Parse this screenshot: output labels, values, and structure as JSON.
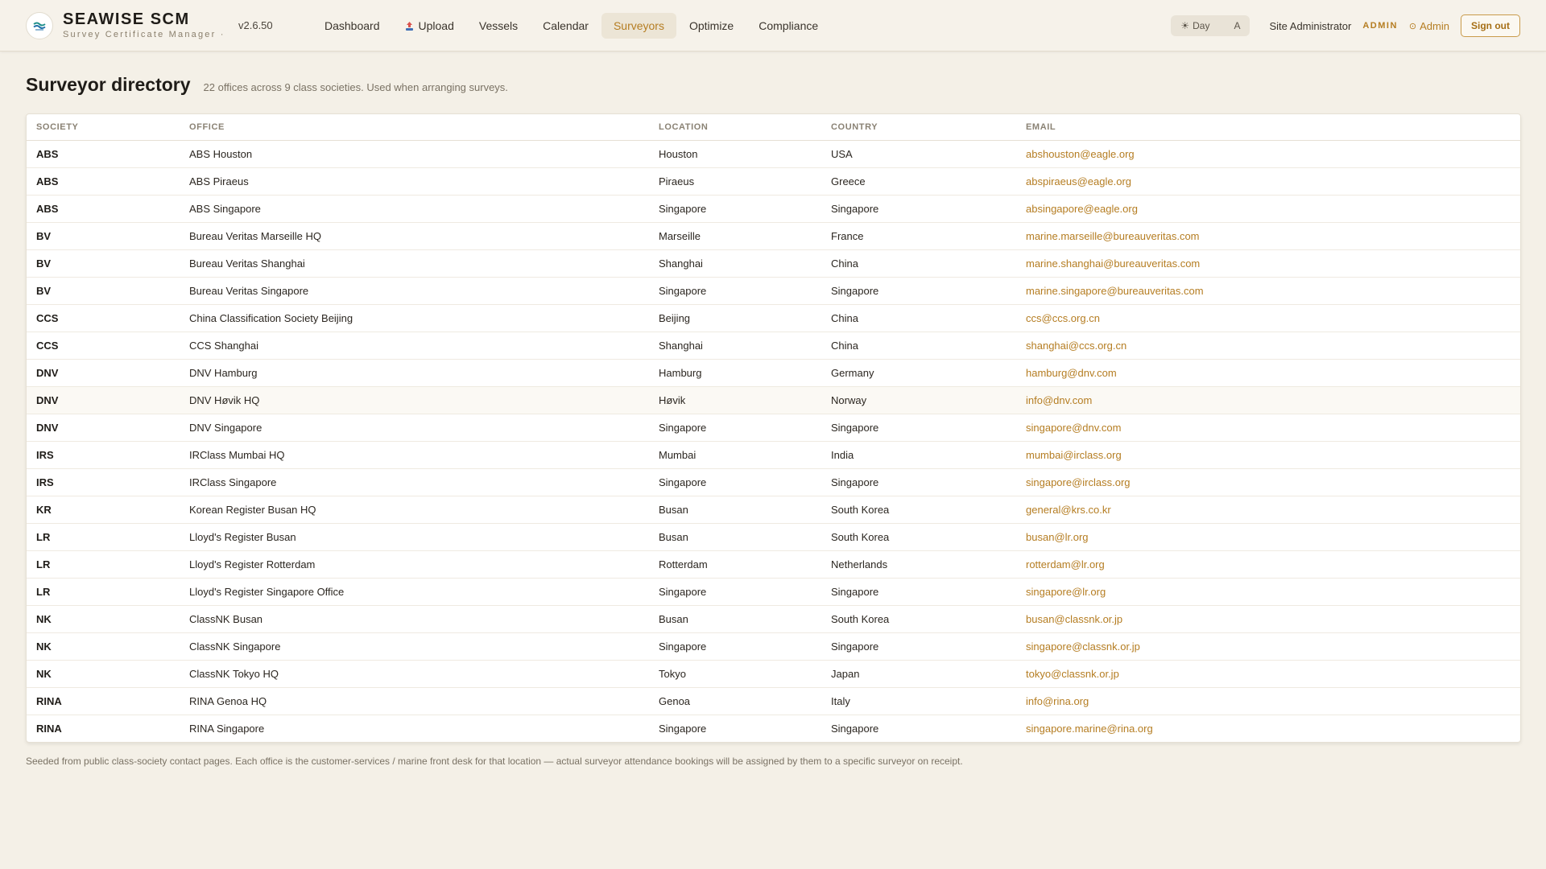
{
  "brand": {
    "name": "SEAWISE SCM",
    "subtitle": "Survey Certificate Manager ·"
  },
  "version": "v2.6.50",
  "nav": [
    {
      "label": "Dashboard",
      "active": false
    },
    {
      "label": "Upload",
      "active": false,
      "icon": "upload-icon"
    },
    {
      "label": "Vessels",
      "active": false
    },
    {
      "label": "Calendar",
      "active": false
    },
    {
      "label": "Surveyors",
      "active": true
    },
    {
      "label": "Optimize",
      "active": false
    },
    {
      "label": "Compliance",
      "active": false
    }
  ],
  "theme": {
    "day_label": "Day",
    "auto_label": "A",
    "day_icon": "sun-icon"
  },
  "user": {
    "name": "Site Administrator",
    "role": "ADMIN",
    "admin_link": "Admin",
    "signout": "Sign out"
  },
  "page": {
    "title": "Surveyor directory",
    "subtitle": "22 offices across 9 class societies. Used when arranging surveys."
  },
  "table": {
    "columns": [
      "SOCIETY",
      "OFFICE",
      "LOCATION",
      "COUNTRY",
      "EMAIL"
    ],
    "rows": [
      [
        "ABS",
        "ABS Houston",
        "Houston",
        "USA",
        "abshouston@eagle.org"
      ],
      [
        "ABS",
        "ABS Piraeus",
        "Piraeus",
        "Greece",
        "abspiraeus@eagle.org"
      ],
      [
        "ABS",
        "ABS Singapore",
        "Singapore",
        "Singapore",
        "absingapore@eagle.org"
      ],
      [
        "BV",
        "Bureau Veritas Marseille HQ",
        "Marseille",
        "France",
        "marine.marseille@bureauveritas.com"
      ],
      [
        "BV",
        "Bureau Veritas Shanghai",
        "Shanghai",
        "China",
        "marine.shanghai@bureauveritas.com"
      ],
      [
        "BV",
        "Bureau Veritas Singapore",
        "Singapore",
        "Singapore",
        "marine.singapore@bureauveritas.com"
      ],
      [
        "CCS",
        "China Classification Society Beijing",
        "Beijing",
        "China",
        "ccs@ccs.org.cn"
      ],
      [
        "CCS",
        "CCS Shanghai",
        "Shanghai",
        "China",
        "shanghai@ccs.org.cn"
      ],
      [
        "DNV",
        "DNV Hamburg",
        "Hamburg",
        "Germany",
        "hamburg@dnv.com"
      ],
      [
        "DNV",
        "DNV Høvik HQ",
        "Høvik",
        "Norway",
        "info@dnv.com"
      ],
      [
        "DNV",
        "DNV Singapore",
        "Singapore",
        "Singapore",
        "singapore@dnv.com"
      ],
      [
        "IRS",
        "IRClass Mumbai HQ",
        "Mumbai",
        "India",
        "mumbai@irclass.org"
      ],
      [
        "IRS",
        "IRClass Singapore",
        "Singapore",
        "Singapore",
        "singapore@irclass.org"
      ],
      [
        "KR",
        "Korean Register Busan HQ",
        "Busan",
        "South Korea",
        "general@krs.co.kr"
      ],
      [
        "LR",
        "Lloyd's Register Busan",
        "Busan",
        "South Korea",
        "busan@lr.org"
      ],
      [
        "LR",
        "Lloyd's Register Rotterdam",
        "Rotterdam",
        "Netherlands",
        "rotterdam@lr.org"
      ],
      [
        "LR",
        "Lloyd's Register Singapore Office",
        "Singapore",
        "Singapore",
        "singapore@lr.org"
      ],
      [
        "NK",
        "ClassNK Busan",
        "Busan",
        "South Korea",
        "busan@classnk.or.jp"
      ],
      [
        "NK",
        "ClassNK Singapore",
        "Singapore",
        "Singapore",
        "singapore@classnk.or.jp"
      ],
      [
        "NK",
        "ClassNK Tokyo HQ",
        "Tokyo",
        "Japan",
        "tokyo@classnk.or.jp"
      ],
      [
        "RINA",
        "RINA Genoa HQ",
        "Genoa",
        "Italy",
        "info@rina.org"
      ],
      [
        "RINA",
        "RINA Singapore",
        "Singapore",
        "Singapore",
        "singapore.marine@rina.org"
      ]
    ],
    "highlighted_row": 9
  },
  "footnote": "Seeded from public class-society contact pages. Each office is the customer-services / marine front desk for that location — actual surveyor attendance bookings will be assigned by them to a specific surveyor on receipt.",
  "colors": {
    "accent": "#b57d22",
    "background": "#f4f0e7",
    "card": "#ffffff"
  }
}
